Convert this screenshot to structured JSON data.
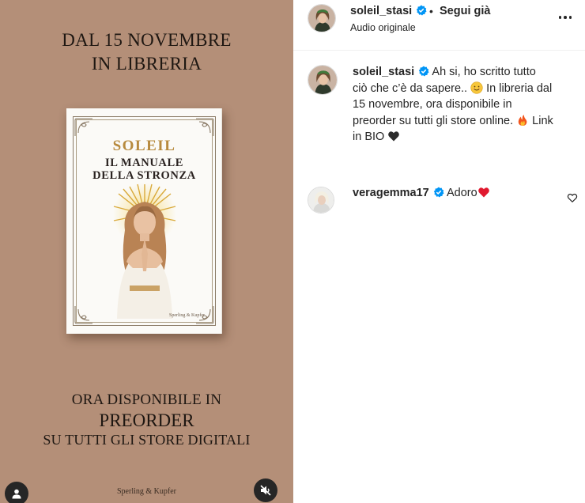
{
  "media": {
    "headline_line1": "DAL 15 NOVEMBRE",
    "headline_line2": "IN LIBRERIA",
    "book": {
      "author": "SOLEIL",
      "title_line1": "IL MANUALE",
      "title_line2": "DELLA STRONZA",
      "publisher": "Sperling & Kupfer"
    },
    "cta_line1": "ORA DISPONIBILE IN",
    "cta_line2": "PREORDER",
    "cta_line3": "SU TUTTI GLI STORE DIGITALI",
    "footer": "Sperling & Kupfer",
    "background_color": "#b48f78",
    "buttons": {
      "user_tag_icon": "user-tag-icon",
      "mute_icon": "speaker-muted-icon"
    }
  },
  "post": {
    "username": "soleil_stasi",
    "separator": "•",
    "follow_status": "Segui già",
    "audio": "Audio originale",
    "more_icon": "more-horizontal-icon",
    "verified_color": "#0095f6"
  },
  "caption": {
    "username": "soleil_stasi",
    "part1": "Ah si, ho scritto tutto ciò che c’è da sapere.. ",
    "emoji1": "smiling-face-emoji",
    "part2": " In libreria dal 15 novembre, ora disponibile in preorder su tutti gli store online. ",
    "emoji2": "fire-emoji",
    "part3": " Link in BIO ",
    "emoji3": "black-heart-emoji"
  },
  "comments": [
    {
      "username": "veragemma17",
      "text": "Adoro",
      "emoji": "red-heart-emoji",
      "like_icon": "heart-outline-icon"
    }
  ]
}
